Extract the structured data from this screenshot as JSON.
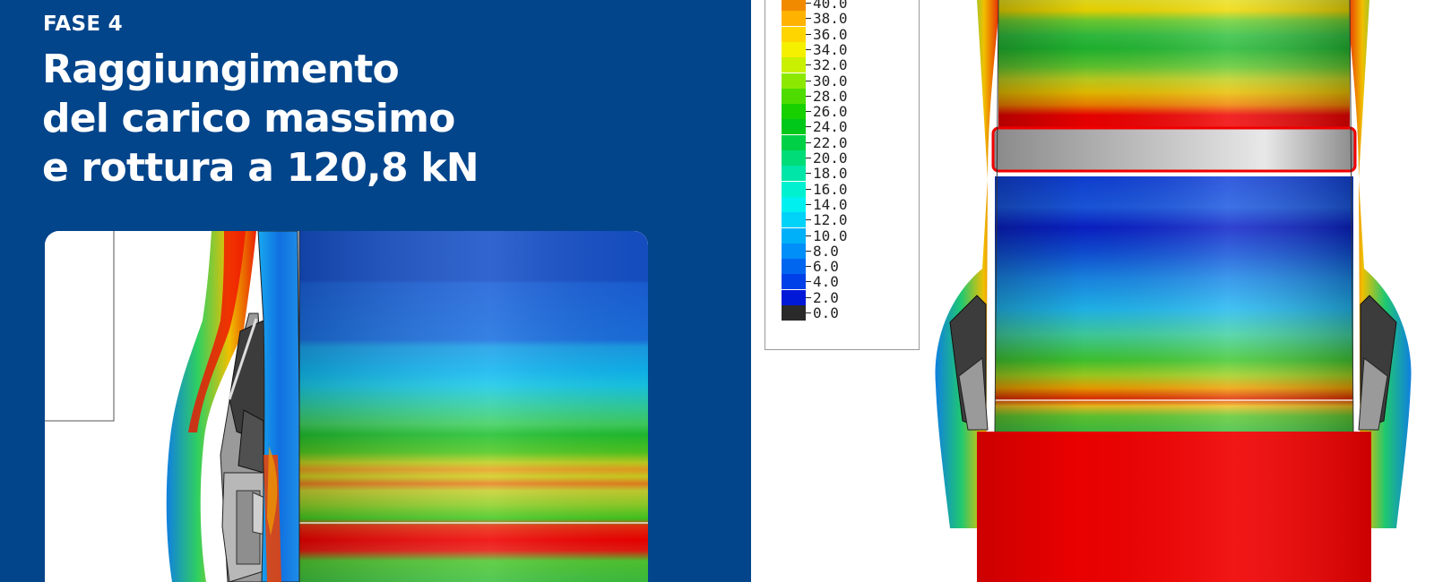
{
  "header": {
    "phase": "FASE 4",
    "title_lines": [
      "Raggiungimento",
      "del carico massimo",
      "e rottura a 120,8 kN"
    ]
  },
  "legend": {
    "entries": [
      {
        "label": "40.0",
        "color": "#f28a00"
      },
      {
        "label": "38.0",
        "color": "#ffb300"
      },
      {
        "label": "36.0",
        "color": "#ffd500"
      },
      {
        "label": "34.0",
        "color": "#f5f000"
      },
      {
        "label": "32.0",
        "color": "#c8f000"
      },
      {
        "label": "30.0",
        "color": "#8ce800"
      },
      {
        "label": "28.0",
        "color": "#4edc00"
      },
      {
        "label": "26.0",
        "color": "#18d000"
      },
      {
        "label": "24.0",
        "color": "#00c81a"
      },
      {
        "label": "22.0",
        "color": "#00d046"
      },
      {
        "label": "20.0",
        "color": "#00dc78"
      },
      {
        "label": "18.0",
        "color": "#00e6a8"
      },
      {
        "label": "16.0",
        "color": "#00f0d0"
      },
      {
        "label": "14.0",
        "color": "#00f0f0"
      },
      {
        "label": "12.0",
        "color": "#00d2f8"
      },
      {
        "label": "10.0",
        "color": "#00b0f8"
      },
      {
        "label": "8.0",
        "color": "#008ef8"
      },
      {
        "label": "6.0",
        "color": "#0066f0"
      },
      {
        "label": "4.0",
        "color": "#0040e8"
      },
      {
        "label": "2.0",
        "color": "#0018d8"
      },
      {
        "label": "0.0",
        "color": "#2a2a2a"
      }
    ]
  },
  "colors": {
    "brand_blue": "#03458b",
    "red": "#e80000",
    "gray_part": "#b4b4b4",
    "dark_part": "#3c3c3c"
  }
}
